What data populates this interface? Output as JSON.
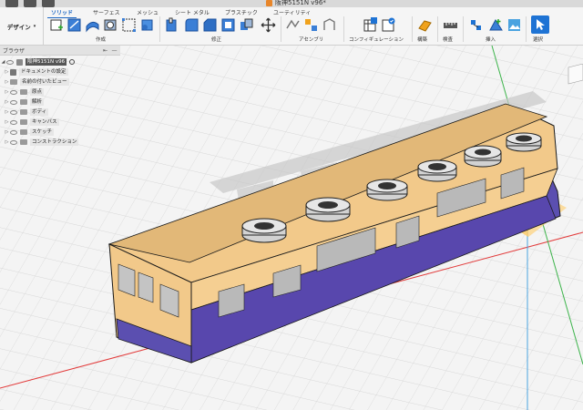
{
  "document": {
    "title": "阪神5151N v96*"
  },
  "toolbar": {
    "workspace": "デザイン",
    "tabs": [
      "ソリッド",
      "サーフェス",
      "メッシュ",
      "シート メタル",
      "プラスチック",
      "ユーティリティ"
    ],
    "active_tab": "ソリッド",
    "groups": [
      "作成",
      "修正",
      "アセンブリ",
      "コンフィギュレーション",
      "構築",
      "検査",
      "挿入",
      "選択"
    ]
  },
  "browser": {
    "title": "ブラウザ",
    "root": "阪神5151N v96",
    "items": [
      "ドキュメントの設定",
      "名前の付いたビュー",
      "原点",
      "解析",
      "ボディ",
      "キャンバス",
      "スケッチ",
      "コンストラクション"
    ]
  },
  "colors": {
    "accent": "#1e73d4",
    "car_body_upper": "#f2c98a",
    "car_body_lower": "#5b4fb0",
    "roof": "#d2d2d2",
    "axis_red": "#e23b3b",
    "axis_green": "#3bb34a",
    "axis_blue": "#4aa3e0",
    "highlight_plane": "#ffcc66"
  }
}
